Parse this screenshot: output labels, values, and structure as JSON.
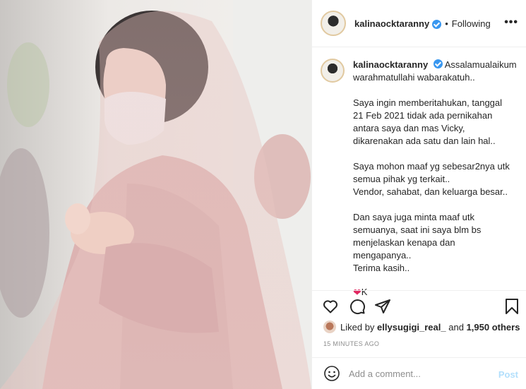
{
  "post": {
    "username": "kalinaocktaranny",
    "follow_state": "Following",
    "separator": "•",
    "more_label": "•••"
  },
  "caption": {
    "username": "kalinaocktaranny",
    "line1": "Assalamualaikum",
    "line2": "warahmatullahi wabarakatuh..",
    "para1": [
      "Saya ingin memberitahukan, tanggal",
      "21 Feb 2021 tidak ada pernikahan",
      "antara saya dan mas Vicky,",
      "dikarenakan ada satu dan lain hal.."
    ],
    "para2": [
      "Saya mohon maaf yg sebesar2nya utk",
      "semua pihak yg terkait..",
      "Vendor, sahabat, dan keluarga besar.."
    ],
    "para3": [
      "Dan saya juga minta maaf utk",
      "semuanya, saat ini saya blm bs",
      "menjelaskan kenapa dan",
      "mengapanya..",
      "Terima kasih.."
    ],
    "heart": "❤",
    "sign": "K"
  },
  "likes": {
    "prefix": "Liked by",
    "user": "ellysugigi_real_",
    "middle": "and",
    "count": "1,950 others"
  },
  "timestamp": "15 MINUTES AGO",
  "comment": {
    "placeholder": "Add a comment...",
    "post_label": "Post"
  },
  "colors": {
    "verified": "#3897f0",
    "post_disabled": "#b2dffc",
    "heart": "#e0245e"
  },
  "icons": [
    "heart-icon",
    "comment-icon",
    "share-icon",
    "bookmark-icon",
    "smiley-icon",
    "verified-badge-icon",
    "more-options-icon"
  ]
}
